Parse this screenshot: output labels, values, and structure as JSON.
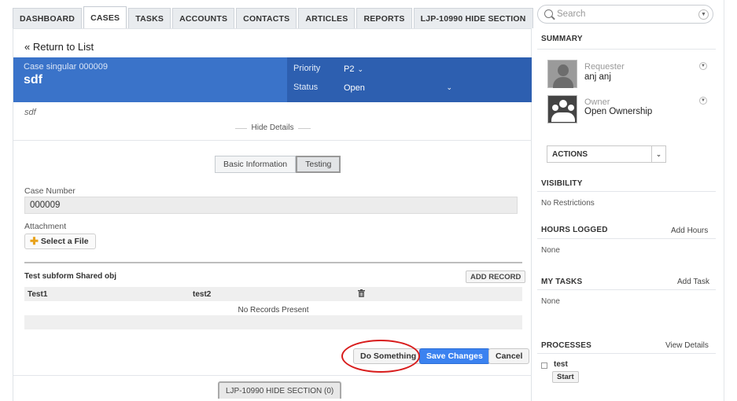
{
  "tabs": [
    {
      "label": "DASHBOARD"
    },
    {
      "label": "CASES"
    },
    {
      "label": "TASKS"
    },
    {
      "label": "ACCOUNTS"
    },
    {
      "label": "CONTACTS"
    },
    {
      "label": "ARTICLES"
    },
    {
      "label": "REPORTS"
    },
    {
      "label": "LJP-10990 HIDE SECTION"
    }
  ],
  "main": {
    "return_link": "« Return to List",
    "case_type": "Case singular 000009",
    "case_title": "sdf",
    "priority_label": "Priority",
    "priority_value": "P2",
    "status_label": "Status",
    "status_value": "Open",
    "description": "sdf",
    "hide_details": "Hide Details",
    "segments": [
      "Basic Information",
      "Testing"
    ],
    "case_number_label": "Case Number",
    "case_number_value": "000009",
    "attachment_label": "Attachment",
    "select_file": "Select a File",
    "subform_title": "Test subform Shared obj",
    "add_record": "ADD RECORD",
    "subform_columns": [
      "Test1",
      "test2"
    ],
    "no_records": "No Records Present",
    "do_something": "Do Something",
    "save_changes": "Save Changes",
    "cancel": "Cancel",
    "bottom_section": "LJP-10990 HIDE SECTION (0)"
  },
  "sidebar": {
    "search_placeholder": "Search",
    "summary_heading": "SUMMARY",
    "requester_label": "Requester",
    "requester_value": "anj anj",
    "owner_label": "Owner",
    "owner_value": "Open Ownership",
    "actions_label": "ACTIONS",
    "visibility_heading": "VISIBILITY",
    "visibility_value": "No Restrictions",
    "hours_heading": "HOURS LOGGED",
    "add_hours": "Add Hours",
    "hours_value": "None",
    "tasks_heading": "MY TASKS",
    "add_task": "Add Task",
    "tasks_value": "None",
    "processes_heading": "PROCESSES",
    "view_details": "View Details",
    "process_name": "test",
    "start_label": "Start"
  },
  "colors": {
    "header_blue": "#3a73c9",
    "header_blue_dark": "#2d5fb0",
    "save_button": "#3b82f0",
    "highlight_ring": "#d81c1c"
  },
  "icons": [
    "search-icon",
    "chevron-down-icon",
    "plus-icon",
    "trash-icon",
    "user-avatar-icon",
    "group-avatar-icon"
  ]
}
